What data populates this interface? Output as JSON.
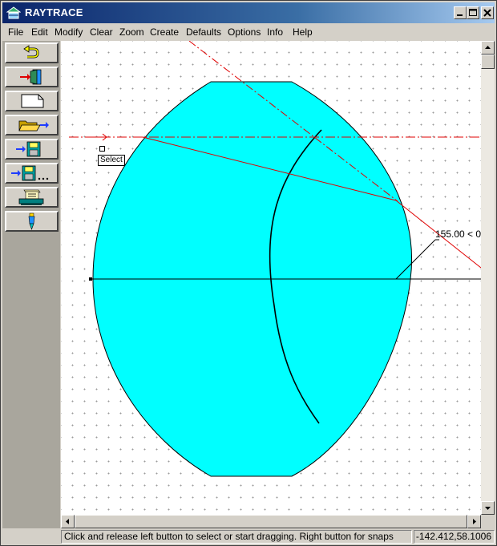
{
  "window": {
    "title": "RAYTRACE",
    "icon": "raytrace-app-icon",
    "controls": [
      "minimize",
      "maximize",
      "close"
    ]
  },
  "menu": [
    "File",
    "Edit",
    "Modify",
    "Clear",
    "Zoom",
    "Create",
    "Defaults",
    "Options",
    "Info",
    "Help"
  ],
  "toolbar": [
    {
      "name": "undo",
      "icon": "undo-arrow-icon"
    },
    {
      "name": "exit",
      "icon": "exit-door-icon"
    },
    {
      "name": "new",
      "icon": "blank-page-icon"
    },
    {
      "name": "open",
      "icon": "open-folder-icon"
    },
    {
      "name": "save",
      "icon": "save-disk-icon"
    },
    {
      "name": "save-as",
      "icon": "save-as-disk-icon"
    },
    {
      "name": "print",
      "icon": "printer-icon"
    },
    {
      "name": "pen",
      "icon": "pen-icon"
    }
  ],
  "canvas": {
    "dimension_label": "155.00 <  0.",
    "tooltip": "Select",
    "colors": {
      "lens_fill": "#00ffff",
      "ray": "#e00000",
      "axis": "#000000",
      "grid_dot": "#9a9a9a"
    }
  },
  "status": {
    "message": "Click and release left button to select or start dragging. Right button for snaps",
    "coordinates": "-142.412,58.1006"
  }
}
